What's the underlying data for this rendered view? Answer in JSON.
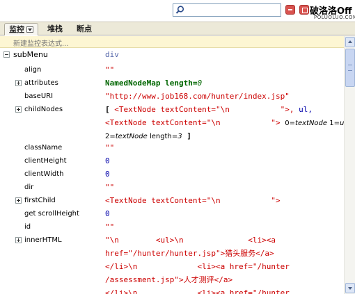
{
  "search": {
    "placeholder": "",
    "value": ""
  },
  "window": {
    "minimize_icon": "minimize-icon",
    "maximize_icon": "maximize-icon"
  },
  "watermark": {
    "main": "破洛洛Off",
    "sub": "POLUOLUO.COM"
  },
  "tabs": [
    {
      "label": "监控",
      "active": true
    },
    {
      "label": "堆栈",
      "active": false
    },
    {
      "label": "断点",
      "active": false
    }
  ],
  "new_watch_placeholder": "新建监控表达式...",
  "root": {
    "name": "subMenu",
    "value": "div"
  },
  "props": {
    "align": {
      "name": "align",
      "value": "\"\""
    },
    "attributes": {
      "name": "attributes",
      "value_a": "NamedNodeMap length=",
      "value_b": "0"
    },
    "baseURI": {
      "name": "baseURI",
      "value": "\"http://www.job168.com/hunter/index.jsp\""
    },
    "childNodes": {
      "name": "childNodes",
      "line1_a": "[ ",
      "line1_b": "<TextNode textContent=\"\\n           \">, ",
      "line1_c": "ul,",
      "line2_a": "<TextNode textContent=\"\\n           \"> ",
      "line2_b": "0=",
      "line2_c": "textNode",
      "line2_d": " 1=",
      "line2_e": "ul",
      "line3_a": "2=",
      "line3_b": "textNode",
      "line3_c": " length=",
      "line3_d": "3",
      "line3_e": " ]"
    },
    "className": {
      "name": "className",
      "value": "\"\""
    },
    "clientHeight": {
      "name": "clientHeight",
      "value": "0"
    },
    "clientWidth": {
      "name": "clientWidth",
      "value": "0"
    },
    "dir": {
      "name": "dir",
      "value": "\"\""
    },
    "firstChild": {
      "name": "firstChild",
      "value": "<TextNode textContent=\"\\n           \">"
    },
    "scrollHeight": {
      "name": "get scrollHeight",
      "value": "0"
    },
    "id": {
      "name": "id",
      "value": "\"\""
    },
    "innerHTML": {
      "name": "innerHTML",
      "lines": [
        "\"\\n        <ul>\\n              <li><a",
        "href=\"/hunter/hunter.jsp\">猎头服务</a>",
        "</li>\\n             <li><a href=\"/hunter",
        "/assessment.jsp\">人才测评</a>",
        "</li>\\n             <li><a href=\"/hunter"
      ]
    }
  }
}
